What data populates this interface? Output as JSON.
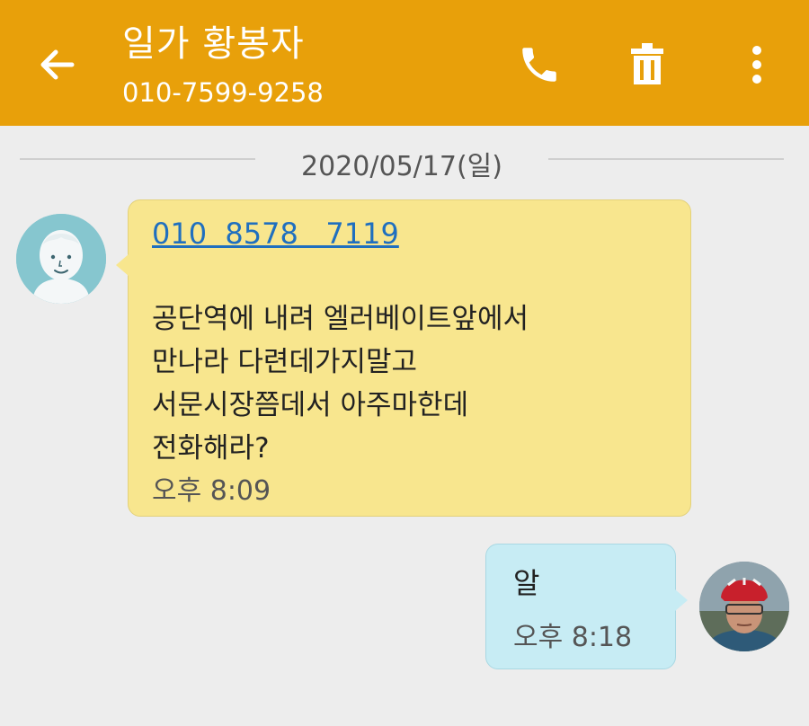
{
  "header": {
    "contact_name": "일가 황봉자",
    "phone_number": "010-7599-9258",
    "bg_color": "#e8a00a",
    "icons": {
      "back": "arrow-left-icon",
      "call": "phone-icon",
      "delete": "trash-icon",
      "more": "more-vertical-icon"
    }
  },
  "date_divider": "2020/05/17(일)",
  "messages": [
    {
      "direction": "incoming",
      "link": "010  8578   7119",
      "lines": [
        "공단역에 내려 엘러베이트앞에서",
        "만나라 다련데가지말고",
        "서문시장쯤데서 아주마한데",
        "전화해라?"
      ],
      "time": "오후 8:09",
      "bubble_color": "#f8e68e"
    },
    {
      "direction": "outgoing",
      "text": "알",
      "time": "오후 8:18",
      "bubble_color": "#c7ecf4"
    }
  ]
}
